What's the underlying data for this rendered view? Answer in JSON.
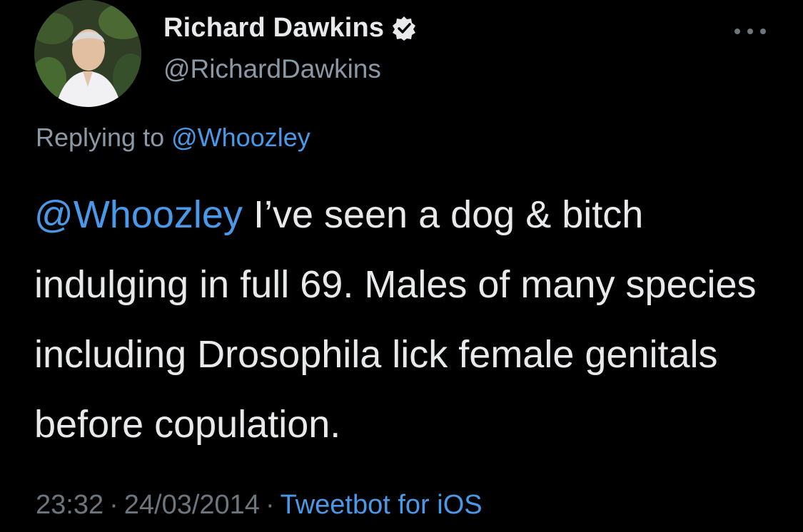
{
  "tweet": {
    "author": {
      "display_name": "Richard Dawkins",
      "handle": "@RichardDawkins",
      "verified": true,
      "avatar_icon": "profile-photo"
    },
    "more_icon": "ellipsis-icon",
    "reply": {
      "prefix": "Replying to",
      "mention": "@Whoozley"
    },
    "body": {
      "mention": "@Whoozley",
      "text": "I’ve seen a dog & bitch indulging in full 69. Males of many species including Drosophila lick female genitals before copulation."
    },
    "meta": {
      "time": "23:32",
      "date": "24/03/2014",
      "separator": "·",
      "source": "Tweetbot for iOS"
    }
  },
  "colors": {
    "background": "#000000",
    "text": "#e7e9ea",
    "secondary": "#8b98a5",
    "link": "#4a99e9"
  }
}
